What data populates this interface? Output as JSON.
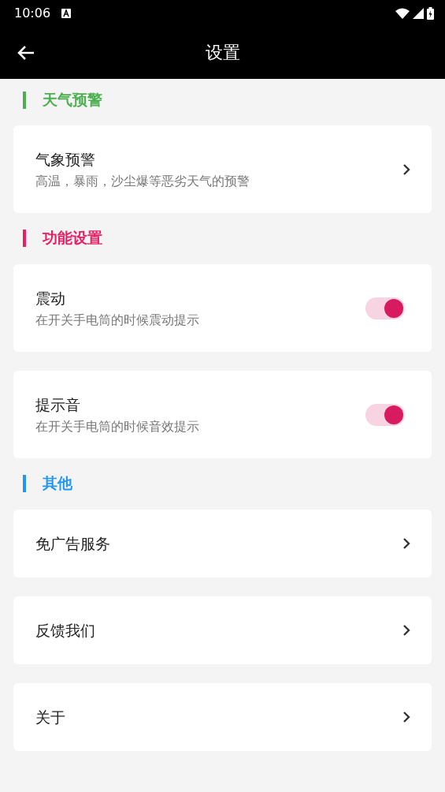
{
  "status_bar": {
    "time": "10:06"
  },
  "app_bar": {
    "title": "设置"
  },
  "sections": [
    {
      "title": "天气预警",
      "color": "#4caf50",
      "items": [
        {
          "kind": "link",
          "title": "气象预警",
          "subtitle": "高温，暴雨，沙尘爆等恶劣天气的预警"
        }
      ]
    },
    {
      "title": "功能设置",
      "color": "#e91e63",
      "items": [
        {
          "kind": "toggle",
          "title": "震动",
          "subtitle": "在开关手电筒的时候震动提示",
          "on": true
        },
        {
          "kind": "toggle",
          "title": "提示音",
          "subtitle": "在开关手电筒的时候音效提示",
          "on": true
        }
      ]
    },
    {
      "title": "其他",
      "color": "#2196f3",
      "items": [
        {
          "kind": "link",
          "title": "免广告服务"
        },
        {
          "kind": "link",
          "title": "反馈我们"
        },
        {
          "kind": "link",
          "title": "关于"
        }
      ]
    }
  ]
}
